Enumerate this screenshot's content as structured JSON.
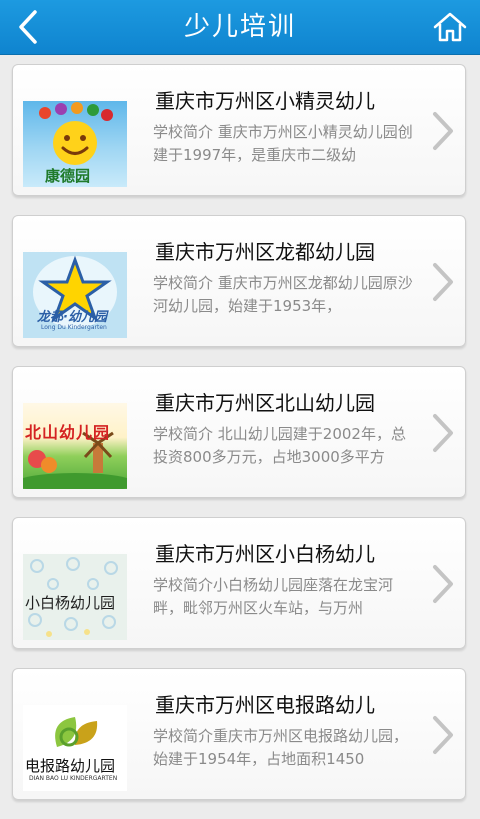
{
  "header": {
    "title": "少儿培训",
    "back_icon": "chevron-left-icon",
    "home_icon": "home-icon",
    "bar_color": "#1791d6"
  },
  "schools": [
    {
      "name": "重庆市万州区小精灵幼儿",
      "desc": "学校简介 重庆市万州区小精灵幼儿园创建于1997年，是重庆市二级幼",
      "logo_text": "康德园"
    },
    {
      "name": "重庆市万州区龙都幼儿园",
      "desc": "学校简介 重庆市万州区龙都幼儿园原沙河幼儿园，始建于1953年，",
      "logo_text": "龙都·幼儿园",
      "logo_subtext": "Long Du Kindergarten"
    },
    {
      "name": "重庆市万州区北山幼儿园",
      "desc": "学校简介 北山幼儿园建于2002年，总投资800多万元，占地3000多平方",
      "logo_text": "北山幼儿园"
    },
    {
      "name": "重庆市万州区小白杨幼儿",
      "desc": "学校简介小白杨幼儿园座落在龙宝河畔，毗邻万州区火车站，与万州",
      "logo_text": "小白杨幼儿园"
    },
    {
      "name": "重庆市万州区电报路幼儿",
      "desc": "学校简介重庆市万州区电报路幼儿园，始建于1954年，占地面积1450",
      "logo_text": "电报路幼儿园",
      "logo_subtext": "DIAN BAO LU KINDERGARTEN"
    }
  ]
}
